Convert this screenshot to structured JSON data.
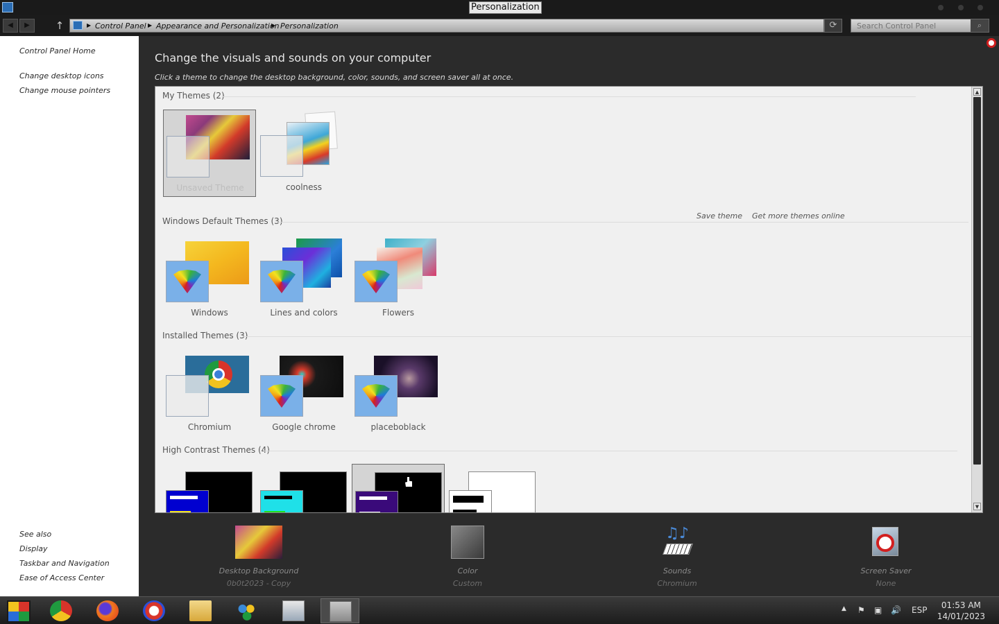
{
  "window": {
    "title": "Personalization"
  },
  "breadcrumb": [
    "Control Panel",
    "Appearance and Personalization",
    "Personalization"
  ],
  "search": {
    "placeholder": "Search Control Panel"
  },
  "sidebar": {
    "links": [
      "Control Panel Home",
      "Change desktop icons",
      "Change mouse pointers"
    ],
    "see_also_heading": "See also",
    "see_also": [
      "Display",
      "Taskbar and Navigation",
      "Ease of Access Center"
    ]
  },
  "main": {
    "title": "Change the visuals and sounds on your computer",
    "subtitle": "Click a theme to change the desktop background, color, sounds, and screen saver all at once."
  },
  "sections": {
    "my_themes": {
      "title": "My Themes (2)",
      "items": [
        "Unsaved Theme",
        "coolness"
      ]
    },
    "default_themes": {
      "title": "Windows Default Themes (3)",
      "items": [
        "Windows",
        "Lines and colors",
        "Flowers"
      ]
    },
    "installed_themes": {
      "title": "Installed Themes (3)",
      "items": [
        "Chromium",
        "Google chrome",
        "placeboblack"
      ]
    },
    "high_contrast": {
      "title": "High Contrast Themes (4)"
    }
  },
  "actions": {
    "save_theme": "Save theme",
    "get_more": "Get more themes online"
  },
  "bottom": [
    {
      "name": "Desktop Background",
      "value": "0b0t2023 - Copy"
    },
    {
      "name": "Color",
      "value": "Custom"
    },
    {
      "name": "Sounds",
      "value": "Chromium"
    },
    {
      "name": "Screen Saver",
      "value": "None"
    }
  ],
  "tray": {
    "lang": "ESP",
    "time": "01:53 AM",
    "date": "14/01/2023"
  }
}
